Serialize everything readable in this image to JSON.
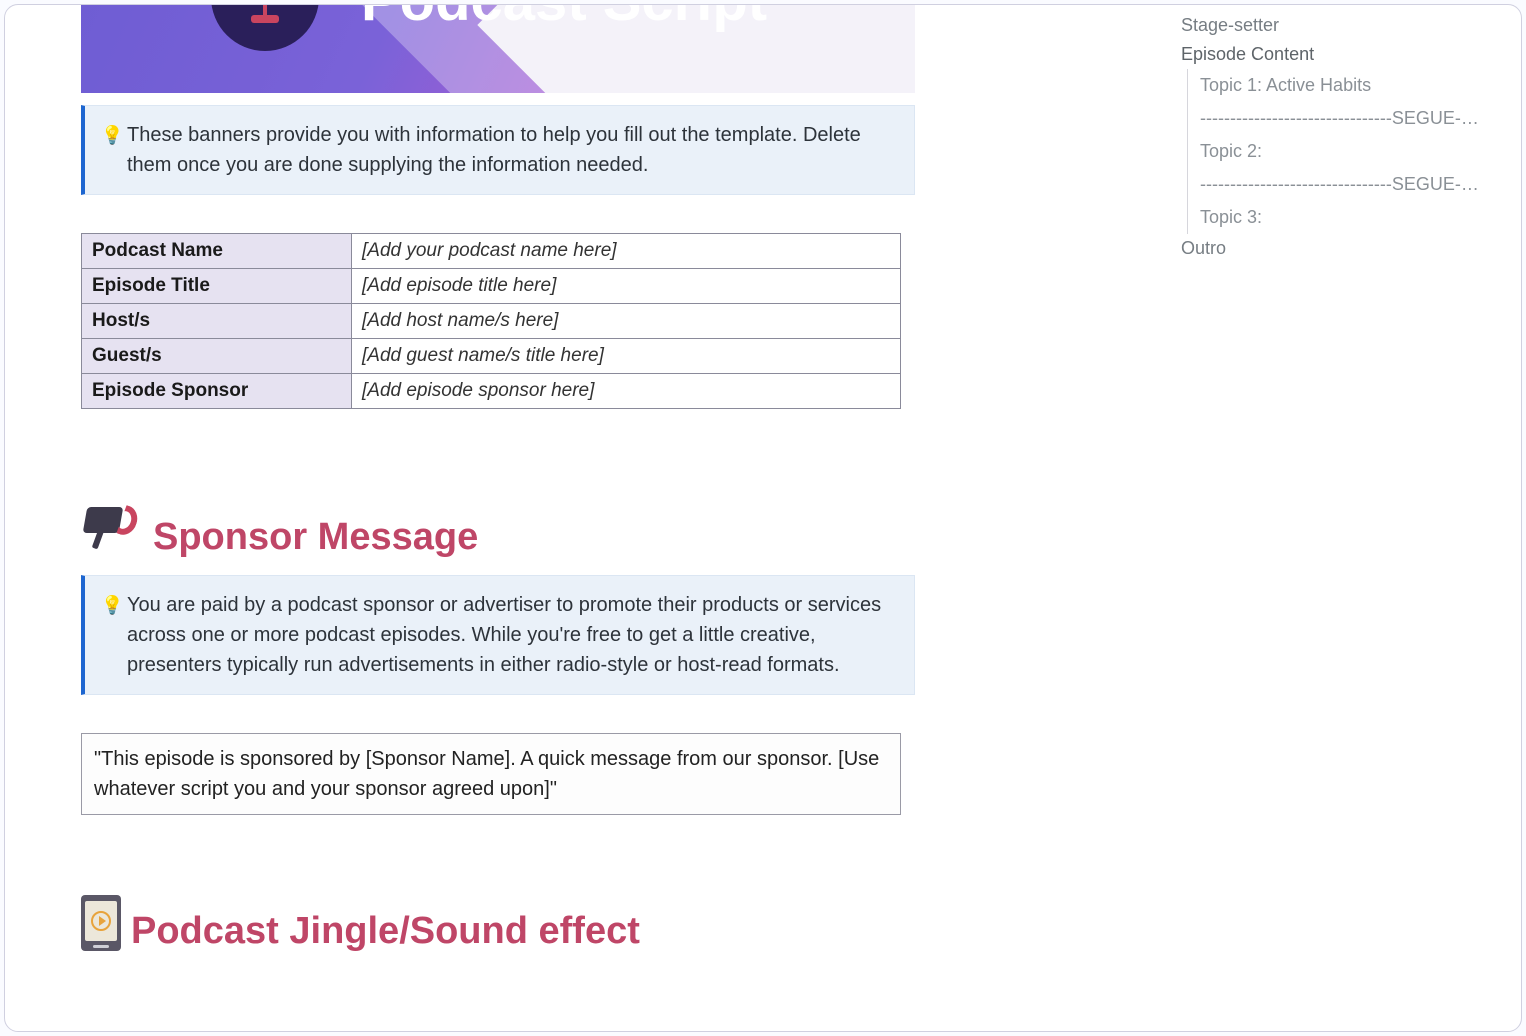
{
  "banner": {
    "title": "Podcast Script"
  },
  "callouts": {
    "intro": "These banners provide you with information to help you fill out the template. Delete them once you are done supplying the information needed.",
    "sponsor": "You are paid by a podcast sponsor or advertiser to promote their products or services across one or more podcast episodes. While you're free to get a little creative, presenters typically run advertisements in either radio-style or host-read formats."
  },
  "meta_table": {
    "rows": [
      {
        "key": "Podcast Name",
        "val": "[Add your podcast name here]"
      },
      {
        "key": "Episode Title",
        "val": "[Add episode title here]"
      },
      {
        "key": "Host/s",
        "val": "[Add host name/s here]"
      },
      {
        "key": "Guest/s",
        "val": "[Add guest name/s title here]"
      },
      {
        "key": "Episode Sponsor",
        "val": "[Add episode sponsor here]"
      }
    ]
  },
  "sections": {
    "sponsor_heading": "Sponsor Message",
    "sponsor_script": "\"This episode is sponsored by [Sponsor Name]. A quick message from our sponsor. [Use whatever script you and your sponsor agreed upon]\"",
    "jingle_heading": "Podcast Jingle/Sound effect"
  },
  "outline": {
    "items": [
      {
        "label": "Stage-setter",
        "level": 1
      },
      {
        "label": "Episode Content",
        "level": 1,
        "bold": true
      },
      {
        "label": "Topic 1: Active Habits",
        "level": 2
      },
      {
        "label": "--------------------------------SEGUE--------------------------------",
        "level": 2
      },
      {
        "label": "Topic 2:",
        "level": 2
      },
      {
        "label": "--------------------------------SEGUE--------------------------------",
        "level": 2
      },
      {
        "label": "Topic 3:",
        "level": 2
      },
      {
        "label": "Outro",
        "level": 1
      }
    ]
  }
}
